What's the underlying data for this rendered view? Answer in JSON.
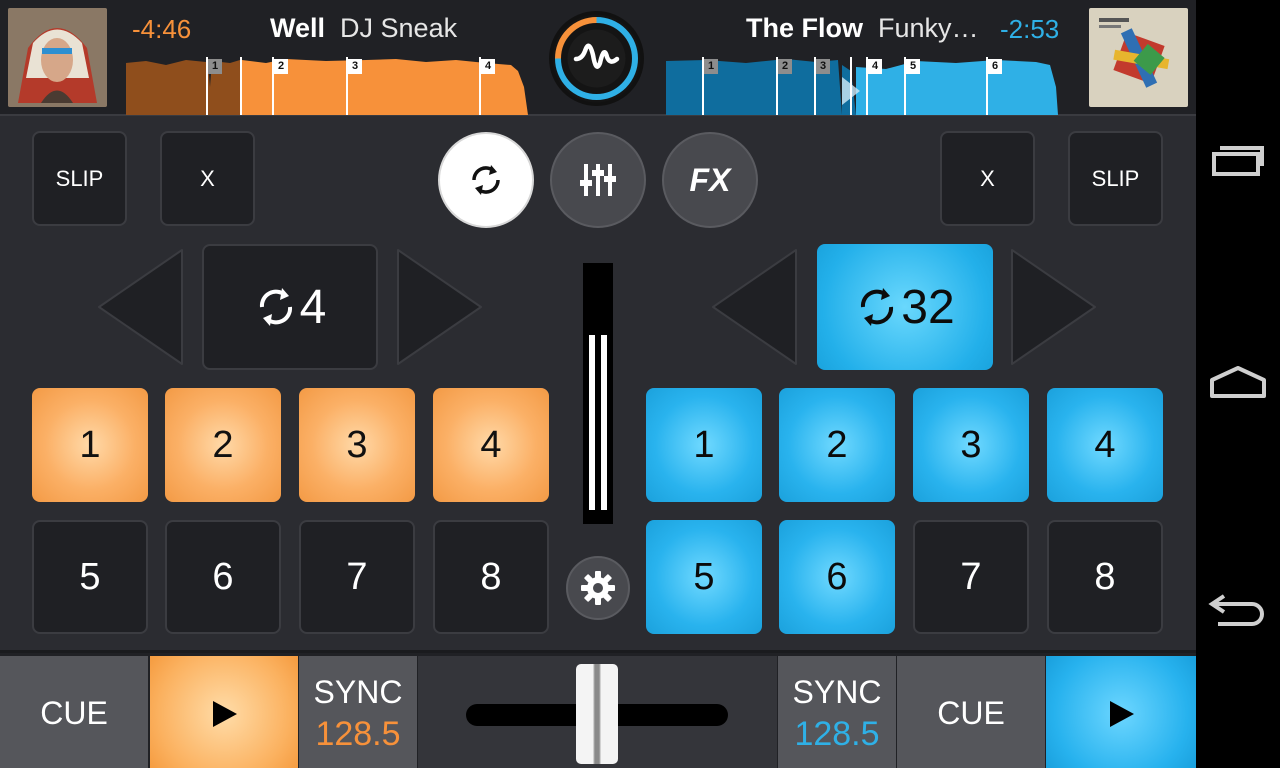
{
  "deck_a": {
    "time_remaining": "-4:46",
    "track_title": "Well",
    "track_artist": "DJ Sneak",
    "cue_markers": [
      "1",
      "2",
      "3",
      "4"
    ],
    "slip_label": "SLIP",
    "clear_label": "X",
    "loop_size": "4",
    "pads": [
      "1",
      "2",
      "3",
      "4",
      "5",
      "6",
      "7",
      "8"
    ],
    "cue_label": "CUE",
    "sync_label": "SYNC",
    "bpm": "128.5"
  },
  "deck_b": {
    "time_remaining": "-2:53",
    "track_title": "The Flow",
    "track_artist": "Funky…",
    "cue_markers": [
      "1",
      "2",
      "3",
      "4",
      "5",
      "6"
    ],
    "slip_label": "SLIP",
    "clear_label": "X",
    "loop_size": "32",
    "pads": [
      "1",
      "2",
      "3",
      "4",
      "5",
      "6",
      "7",
      "8"
    ],
    "cue_label": "CUE",
    "sync_label": "SYNC",
    "bpm": "128.5"
  },
  "center": {
    "fx_label": "FX",
    "crossfader_position": 0.5
  },
  "colors": {
    "deck_a_accent": "#f7913a",
    "deck_b_accent": "#2fb0e6",
    "background": "#2b2c31"
  },
  "icons": {
    "sync_loop": "loop-arrows-icon",
    "mixer": "mixer-sliders-icon",
    "settings": "gear-icon",
    "play": "play-icon",
    "logo": "waveform-logo-icon",
    "nav_recents": "recent-apps-icon",
    "nav_home": "home-icon",
    "nav_back": "back-icon"
  }
}
